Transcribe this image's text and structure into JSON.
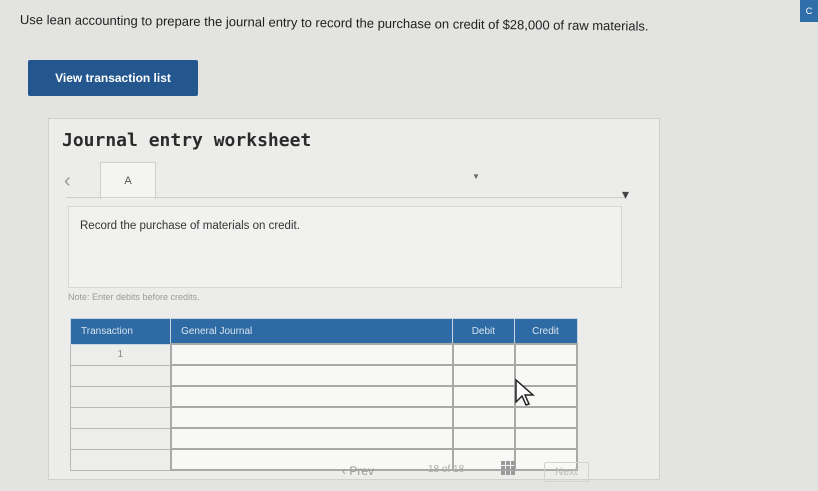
{
  "question": "Use lean accounting to prepare the journal entry to record the purchase on credit of $28,000 of raw materials.",
  "corner_button_label": "C",
  "view_button_label": "View transaction list",
  "worksheet": {
    "title": "Journal entry worksheet",
    "tab_label": "A",
    "instruction": "Record the purchase of materials on credit.",
    "note": "Note: Enter debits before credits."
  },
  "table": {
    "headers": {
      "transaction": "Transaction",
      "general_journal": "General Journal",
      "debit": "Debit",
      "credit": "Credit"
    },
    "first_transaction": "1"
  },
  "footer": {
    "prev_label": "Prev",
    "page_current": "18",
    "page_sep": "of",
    "page_total": "18",
    "next_label": "Next"
  }
}
